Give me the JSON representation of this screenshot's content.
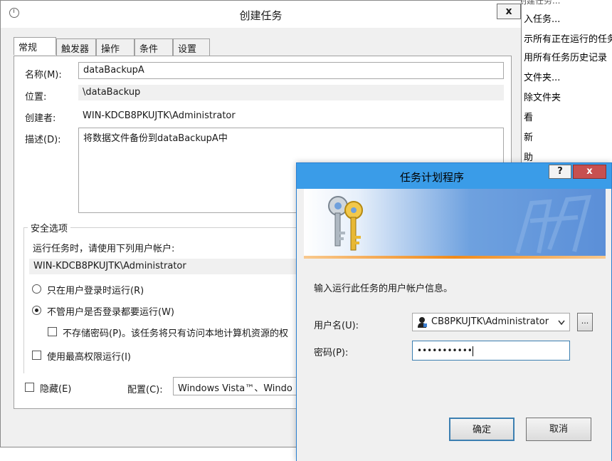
{
  "bg_actions": {
    "top_partial": "创建任务...",
    "items": [
      "入任务...",
      "示所有正在运行的任务",
      "用所有任务历史记录",
      "文件夹...",
      "除文件夹",
      "看",
      "新",
      "助"
    ]
  },
  "create_task": {
    "title": "创建任务",
    "close": "x",
    "tabs": [
      "常规",
      "触发器",
      "操作",
      "条件",
      "设置"
    ],
    "name_label": "名称(M):",
    "name_value": "dataBackupA",
    "location_label": "位置:",
    "location_value": "\\dataBackup",
    "author_label": "创建者:",
    "author_value": "WIN-KDCB8PKUJTK\\Administrator",
    "description_label": "描述(D):",
    "description_value": "将数据文件备份到dataBackupA中",
    "security_title": "安全选项",
    "run_as_label": "运行任务时，请使用下列用户帐户:",
    "run_as_value": "WIN-KDCB8PKUJTK\\Administrator",
    "radio_logged_on": "只在用户登录时运行(R)",
    "radio_whether": "不管用户是否登录都要运行(W)",
    "no_store_password": "不存储密码(P)。该任务将只有访问本地计算机资源的权",
    "highest_privileges": "使用最高权限运行(I)",
    "hidden": "隐藏(E)",
    "configure_label": "配置(C):",
    "configure_value": "Windows Vista™、Windo"
  },
  "scheduler_dialog": {
    "title": "任务计划程序",
    "help": "?",
    "close": "x",
    "prompt": "输入运行此任务的用户帐户信息。",
    "username_label": "用户名(U):",
    "username_value": "CB8PKUJTK\\Administrator",
    "browse": "...",
    "password_label": "密码(P):",
    "password_value": "•••••••••••",
    "ok": "确定",
    "cancel": "取消"
  },
  "colors": {
    "dialog_title_bar": "#3a9ce8",
    "close_red": "#c75050",
    "banner_accent": "#f08a1a"
  },
  "icons": [
    "app-icon",
    "keys-icon",
    "user-icon",
    "chevron-down-icon"
  ]
}
